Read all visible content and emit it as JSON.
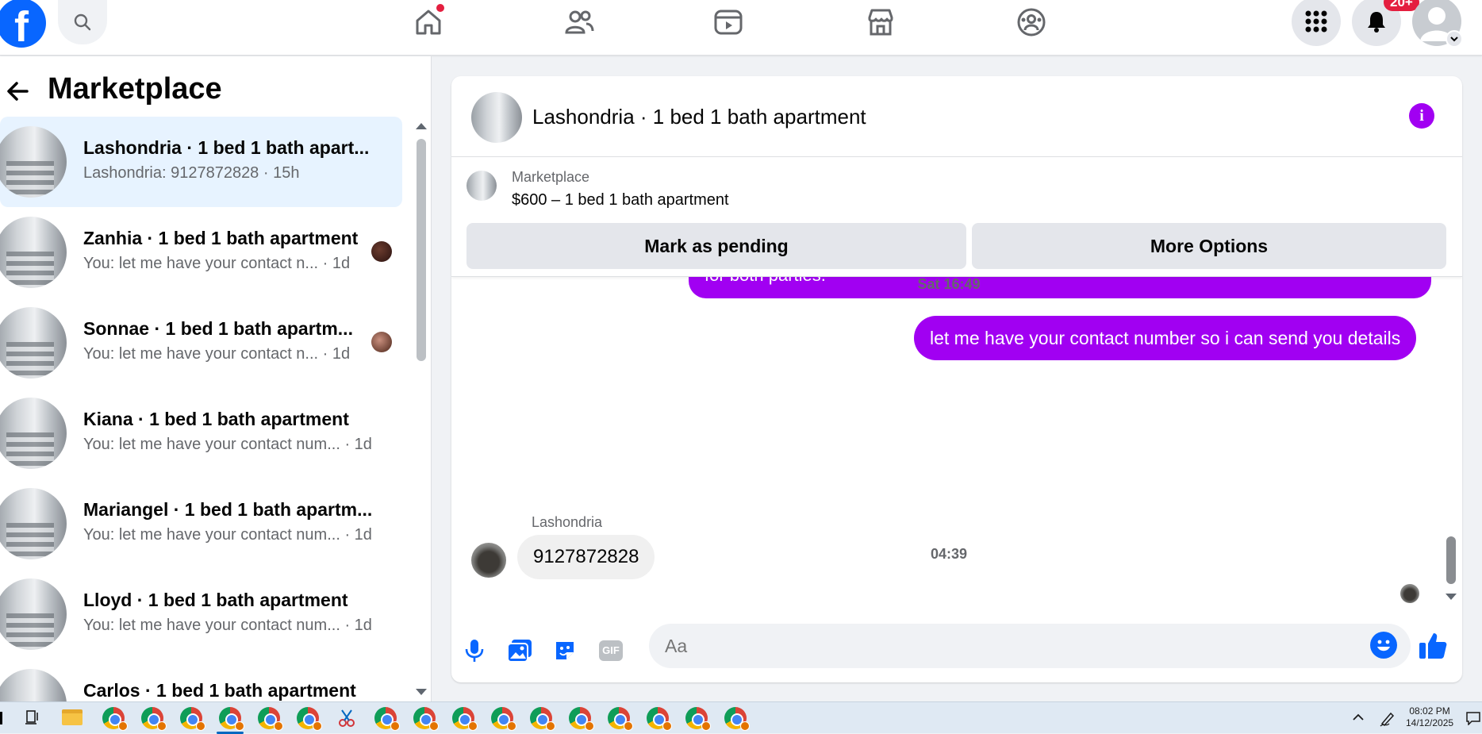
{
  "nav": {
    "logo_letter": "f",
    "notifications_badge": "20+"
  },
  "sidebar": {
    "title": "Marketplace",
    "conversations": [
      {
        "name": "Lashondria · 1 bed 1 bath apart...",
        "preview": "Lashondria: 9127872828 · 15h",
        "active": true
      },
      {
        "name": "Zanhia · 1 bed 1 bath apartment",
        "preview": "You: let me have your contact n...  · 1d"
      },
      {
        "name": "Sonnae · 1 bed 1 bath apartm...",
        "preview": "You: let me have your contact n...  · 1d"
      },
      {
        "name": "Kiana · 1 bed 1 bath apartment",
        "preview": "You: let me have your contact num... · 1d"
      },
      {
        "name": "Mariangel · 1 bed 1 bath apartm...",
        "preview": "You: let me have your contact num... · 1d"
      },
      {
        "name": "Lloyd · 1 bed 1 bath apartment",
        "preview": "You: let me have your contact num... · 1d"
      },
      {
        "name": "Carlos · 1 bed 1 bath apartment",
        "preview": ""
      }
    ]
  },
  "chat": {
    "title": "Lashondria · 1 bed 1 bath apartment",
    "info_glyph": "i",
    "listing": {
      "label": "Marketplace",
      "price_title": "$600 – 1 bed 1 bath apartment",
      "mark_pending_label": "Mark as pending",
      "more_options_label": "More Options"
    },
    "messages": {
      "outgoing_1": "screenshot of your score for verification. This step ensures a smooth and efficient process for both parties.",
      "timestamp_1": "Sat 16:49",
      "outgoing_2": "let me have your contact number so i can send you details",
      "timestamp_2": "04:39",
      "incoming_sender": "Lashondria",
      "incoming_1": "9127872828"
    },
    "composer": {
      "placeholder": "Aa",
      "gif_label": "GIF"
    }
  },
  "taskbar": {
    "time": "08:02 PM",
    "date": "14/12/2025"
  },
  "colors": {
    "fb_blue": "#0866ff",
    "outgoing_bubble": "#a100f2",
    "active_conversation": "#e7f3ff",
    "notification_red": "#e41e3f"
  }
}
